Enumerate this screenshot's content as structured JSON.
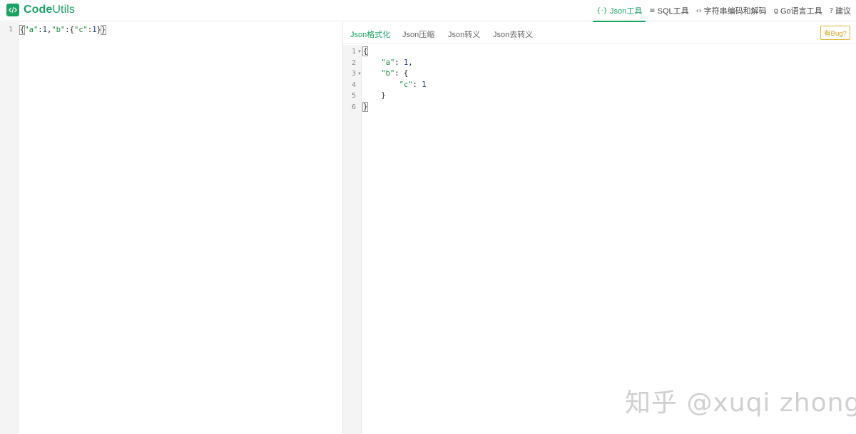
{
  "app": {
    "logo_bold": "Code",
    "logo_light": "Utils",
    "logo_icon": "code-brackets-icon"
  },
  "nav": [
    {
      "icon": "{·}",
      "icon_name": "json-braces-icon",
      "label": "Json工具",
      "active": true
    },
    {
      "icon": "≡",
      "icon_name": "database-icon",
      "label": "SQL工具",
      "active": false
    },
    {
      "icon": "‹›",
      "icon_name": "code-angle-icon",
      "label": "字符串编码和解码",
      "active": false
    },
    {
      "icon": "g",
      "icon_name": "go-icon",
      "label": "Go语言工具",
      "active": false
    },
    {
      "icon": "?",
      "icon_name": "question-circle-icon",
      "label": "建议",
      "active": false
    }
  ],
  "input_editor": {
    "line_numbers": [
      "1"
    ],
    "content": "{\"a\":1,\"b\":{\"c\":1}}"
  },
  "tabs": [
    {
      "label": "Json格式化",
      "active": true
    },
    {
      "label": "Json压缩",
      "active": false
    },
    {
      "label": "Json转义",
      "active": false
    },
    {
      "label": "Json去转义",
      "active": false
    }
  ],
  "bug_button": "有Bug?",
  "output_editor": {
    "line_numbers": [
      "1",
      "2",
      "3",
      "4",
      "5",
      "6"
    ],
    "lines": [
      "{",
      "    \"a\": 1,",
      "    \"b\": {",
      "        \"c\": 1",
      "    }",
      "}"
    ]
  },
  "watermark": "知乎 @xuqi zhong"
}
